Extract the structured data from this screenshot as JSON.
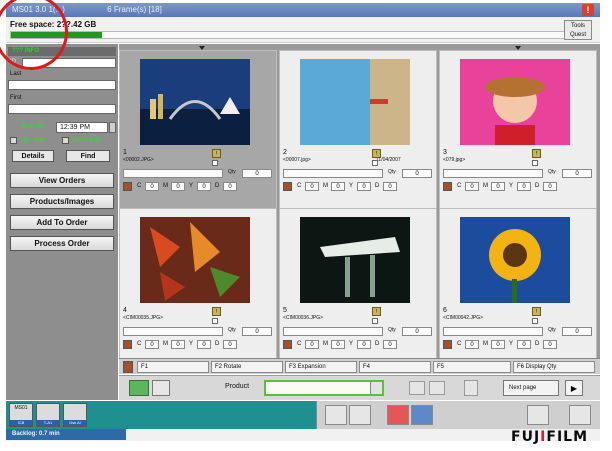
{
  "titlebar": {
    "left": "MS01  3.0 1(...)",
    "right": "6 Frame(s) [18]"
  },
  "free_space": {
    "label": "Free space: 2??.42 GB",
    "percent": 16
  },
  "tools": {
    "label_top": "Tools",
    "label_bottom": "Quest"
  },
  "sidebar": {
    "header": "???  INFO",
    "id_label": "ID",
    "last_label": "Last",
    "first_label": "First",
    "due_by": "DUE BY",
    "time": "12:39 PM",
    "opt1": "?ST JOB",
    "opt2": "NEXT DAY",
    "details_btn": "Details",
    "find_btn": "Find",
    "view_orders": "View Orders",
    "products_images": "Products/Images",
    "add_to_order": "Add To Order",
    "process_order": "Process Order"
  },
  "frames": [
    {
      "num": "1",
      "name": "<00002.JPG>",
      "date": "",
      "qty": "0"
    },
    {
      "num": "2",
      "name": "<00007.jpg>",
      "date": "11/04/2007",
      "qty": "0"
    },
    {
      "num": "3",
      "name": "<079.jpg>",
      "date": "",
      "qty": "0"
    },
    {
      "num": "4",
      "name": "<CIM00035.JPG>",
      "date": "",
      "qty": "0"
    },
    {
      "num": "5",
      "name": "<CIM00036.JPG>",
      "date": "",
      "qty": "0"
    },
    {
      "num": "6",
      "name": "<CIM00042.JPG>",
      "date": "",
      "qty": "0"
    }
  ],
  "frame_ctl": {
    "qty_label": "Qty",
    "c": "C",
    "m": "M",
    "y": "Y",
    "d": "D",
    "val": "0"
  },
  "fkeys": [
    "F1",
    "F2 Rotate",
    "F3 Expansion",
    "F4",
    "F5",
    "F6 Display Qty"
  ],
  "product_bar": {
    "label": "Product",
    "next_page": "Next page"
  },
  "footer": {
    "stations": [
      {
        "top": "MS01",
        "label": "ICB"
      },
      {
        "top": "",
        "label": "T-A1"
      },
      {
        "top": "",
        "label": "Dsk Al"
      }
    ],
    "backlog": "Backlog: 0.7 min",
    "brand_prefix": "FUJ",
    "brand_i": "I",
    "brand_suffix": "FILM"
  },
  "colors": {
    "title": "#5a79b8",
    "meter": "#1f9a1f",
    "station": "#1f8f8f",
    "product_input": "#5cbf3b"
  }
}
